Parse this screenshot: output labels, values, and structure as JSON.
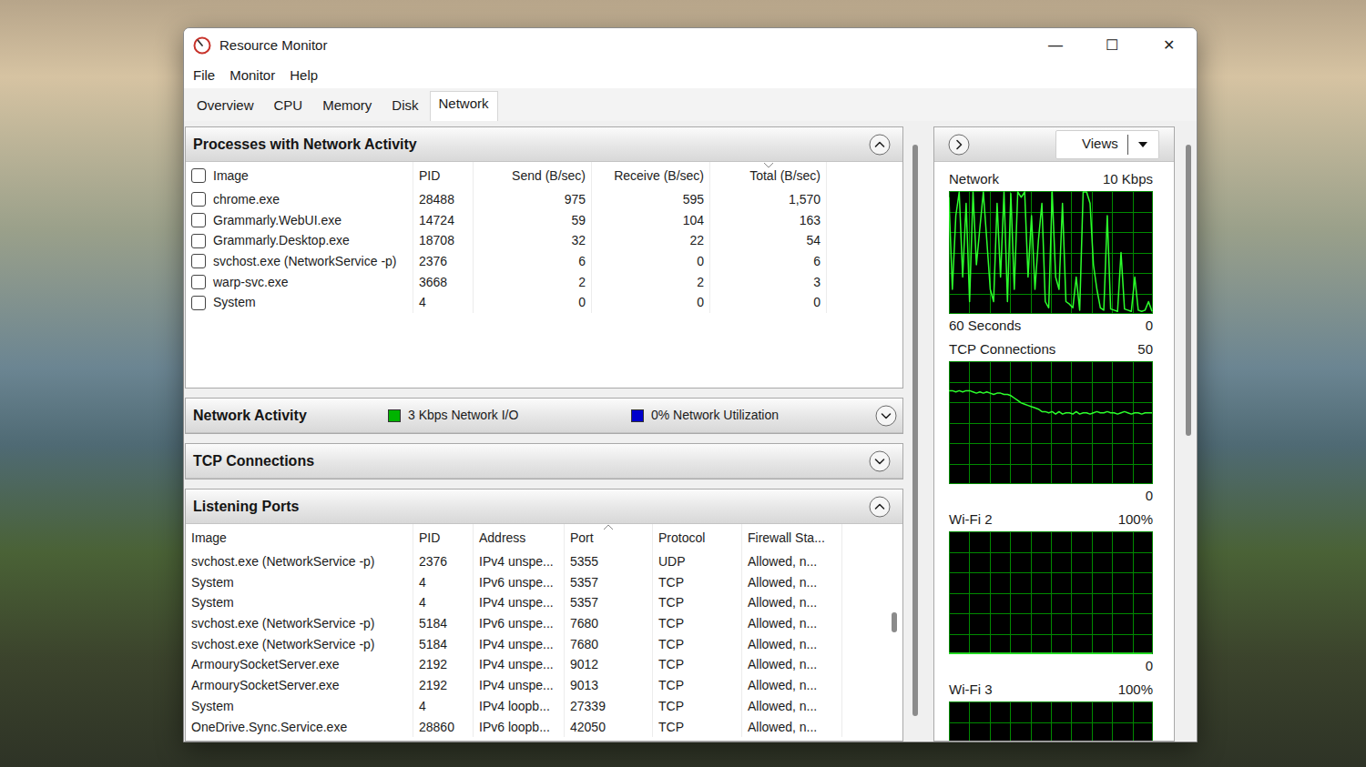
{
  "window": {
    "title": "Resource Monitor",
    "controls": [
      "—",
      "☐",
      "✕"
    ]
  },
  "menu": [
    "File",
    "Monitor",
    "Help"
  ],
  "tabs": [
    {
      "label": "Overview",
      "selected": false
    },
    {
      "label": "CPU",
      "selected": false
    },
    {
      "label": "Memory",
      "selected": false
    },
    {
      "label": "Disk",
      "selected": false
    },
    {
      "label": "Network",
      "selected": true
    }
  ],
  "processes": {
    "title": "Processes with Network Activity",
    "expanded": true,
    "select_all": false,
    "columns": [
      {
        "label": "Image",
        "sort": "none"
      },
      {
        "label": "PID",
        "sort": "none"
      },
      {
        "label": "Send (B/sec)",
        "sort": "none"
      },
      {
        "label": "Receive (B/sec)",
        "sort": "none"
      },
      {
        "label": "Total (B/sec)",
        "sort": "descending"
      }
    ],
    "rows": [
      {
        "checked": false,
        "cells": [
          "chrome.exe",
          "28488",
          "975",
          "595",
          "1,570"
        ]
      },
      {
        "checked": false,
        "cells": [
          "Grammarly.WebUI.exe",
          "14724",
          "59",
          "104",
          "163"
        ]
      },
      {
        "checked": false,
        "cells": [
          "Grammarly.Desktop.exe",
          "18708",
          "32",
          "22",
          "54"
        ]
      },
      {
        "checked": false,
        "cells": [
          "svchost.exe (NetworkService -p)",
          "2376",
          "6",
          "0",
          "6"
        ]
      },
      {
        "checked": false,
        "cells": [
          "warp-svc.exe",
          "3668",
          "2",
          "2",
          "3"
        ]
      },
      {
        "checked": false,
        "cells": [
          "System",
          "4",
          "0",
          "0",
          "0"
        ]
      }
    ]
  },
  "network_activity": {
    "title": "Network Activity",
    "expanded": false,
    "legend": [
      {
        "label": "3 Kbps Network I/O",
        "color": "#00b400"
      },
      {
        "label": "0% Network Utilization",
        "color": "#0000cc"
      }
    ]
  },
  "tcp_connections": {
    "title": "TCP Connections",
    "expanded": false
  },
  "listening_ports": {
    "title": "Listening Ports",
    "expanded": true,
    "scroll": 0.45,
    "columns": [
      {
        "label": "Image",
        "sort": "none"
      },
      {
        "label": "PID",
        "sort": "none"
      },
      {
        "label": "Address",
        "sort": "none"
      },
      {
        "label": "Port",
        "sort": "ascending"
      },
      {
        "label": "Protocol",
        "sort": "none"
      },
      {
        "label": "Firewall Sta...",
        "sort": "none"
      }
    ],
    "rows": [
      [
        "svchost.exe (NetworkService -p)",
        "2376",
        "IPv4 unspe...",
        "5355",
        "UDP",
        "Allowed, n..."
      ],
      [
        "System",
        "4",
        "IPv6 unspe...",
        "5357",
        "TCP",
        "Allowed, n..."
      ],
      [
        "System",
        "4",
        "IPv4 unspe...",
        "5357",
        "TCP",
        "Allowed, n..."
      ],
      [
        "svchost.exe (NetworkService -p)",
        "5184",
        "IPv6 unspe...",
        "7680",
        "TCP",
        "Allowed, n..."
      ],
      [
        "svchost.exe (NetworkService -p)",
        "5184",
        "IPv4 unspe...",
        "7680",
        "TCP",
        "Allowed, n..."
      ],
      [
        "ArmourySocketServer.exe",
        "2192",
        "IPv4 unspe...",
        "9012",
        "TCP",
        "Allowed, n..."
      ],
      [
        "ArmourySocketServer.exe",
        "2192",
        "IPv4 unspe...",
        "9013",
        "TCP",
        "Allowed, n..."
      ],
      [
        "System",
        "4",
        "IPv4 loopb...",
        "27339",
        "TCP",
        "Allowed, n..."
      ],
      [
        "OneDrive.Sync.Service.exe",
        "28860",
        "IPv6 loopb...",
        "42050",
        "TCP",
        "Allowed, n..."
      ]
    ]
  },
  "side": {
    "views": "Views",
    "charts": [
      {
        "title": "Network",
        "max": "10 Kbps",
        "min": "0",
        "span": "60 Seconds",
        "values": [
          9.5,
          2,
          8,
          10,
          3,
          9,
          1,
          10,
          4,
          7,
          10,
          6,
          2,
          1,
          9,
          3,
          10,
          1,
          9.8,
          2,
          10,
          9.5,
          10,
          3,
          8,
          2,
          6,
          9,
          1,
          0.5,
          10,
          3,
          2,
          9,
          1,
          0.8,
          0.5,
          3,
          0.3,
          10,
          10,
          9,
          4,
          2,
          0.5,
          0.3,
          8,
          0.4,
          0.3,
          0.2,
          5,
          0.4,
          0.3,
          0.2,
          3,
          0.3,
          0.2,
          0.3,
          1,
          0.2
        ]
      },
      {
        "title": "TCP Connections",
        "max": "50",
        "min": "0",
        "values": [
          38,
          38,
          37.5,
          38,
          37.5,
          38,
          38,
          37.5,
          37,
          37.5,
          37,
          37.5,
          37,
          36.5,
          37,
          37,
          36.5,
          36.5,
          36,
          35,
          34,
          33,
          32.5,
          32,
          31.5,
          31,
          30.5,
          29.5,
          29.5,
          29,
          29.5,
          28.5,
          29.5,
          28.5,
          29,
          29,
          28.5,
          29.5,
          28.5,
          29,
          29,
          28.5,
          29,
          29.5,
          29,
          29,
          29.5,
          29,
          29,
          28.5,
          29,
          29.5,
          29,
          28.5,
          29,
          29,
          28.5,
          29,
          29,
          29
        ]
      },
      {
        "title": "Wi-Fi 2",
        "max": "100%",
        "min": "0",
        "values": [
          0,
          0,
          0,
          0,
          0,
          0,
          0,
          0,
          0,
          0,
          0,
          0,
          0,
          0,
          0,
          0,
          0,
          0,
          0,
          0,
          0,
          0,
          0,
          0,
          0,
          0,
          0,
          0,
          0,
          0
        ]
      },
      {
        "title": "Wi-Fi 3",
        "max": "100%",
        "values": [
          0,
          0,
          0,
          0,
          0,
          0,
          0,
          0,
          0,
          0,
          0,
          0,
          0,
          0,
          0,
          0,
          0,
          0,
          0,
          0,
          0,
          0,
          0,
          0,
          0,
          0,
          0,
          0,
          0,
          0
        ]
      }
    ]
  }
}
